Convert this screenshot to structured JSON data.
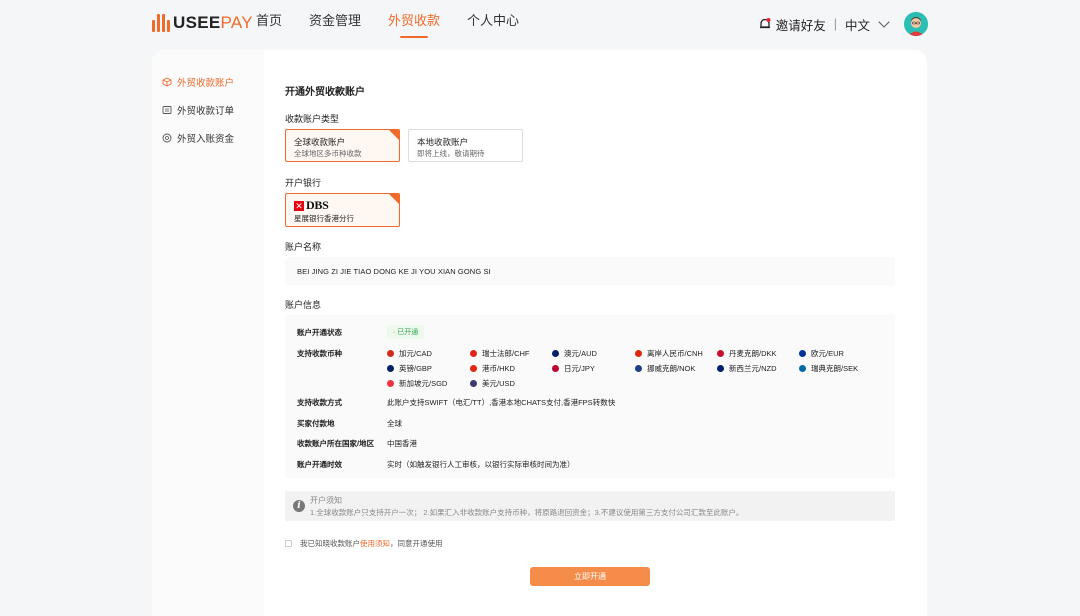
{
  "brand": {
    "logo_text": "USEE",
    "logo_text_accent": "PAY",
    "accent_color": "#f06b2b"
  },
  "nav": [
    {
      "label": "首页",
      "active": false
    },
    {
      "label": "资金管理",
      "active": false
    },
    {
      "label": "外贸收款",
      "active": true
    },
    {
      "label": "个人中心",
      "active": false
    }
  ],
  "header_right": {
    "invite": "邀请好友",
    "separator": "|",
    "language": "中文"
  },
  "sidebar": {
    "items": [
      {
        "label": "外贸收款账户",
        "icon": "box-icon",
        "active": true
      },
      {
        "label": "外贸收款订单",
        "icon": "list-icon",
        "active": false
      },
      {
        "label": "外贸入账资金",
        "icon": "coin-icon",
        "active": false
      }
    ]
  },
  "page": {
    "title": "开通外贸收款账户",
    "account_type_label": "收款账户类型",
    "account_types": [
      {
        "title": "全球收款账户",
        "subtitle": "全球地区多币种收款",
        "selected": true
      },
      {
        "title": "本地收款账户",
        "subtitle": "即将上线，敬请期待",
        "selected": false
      }
    ],
    "bank_label": "开户银行",
    "bank": {
      "logo": "DBS",
      "name": "星展银行香港分行"
    },
    "account_name_label": "账户名称",
    "account_name": "BEI JING ZI JIE TIAO DONG KE JI YOU XIAN GONG SI",
    "account_info_label": "账户信息",
    "info": {
      "status_key": "账户开通状态",
      "status_val": "· 已开通",
      "currency_key": "支持收款币种",
      "currencies": [
        {
          "label": "加元/CAD",
          "color": "#d52b1e"
        },
        {
          "label": "瑞士法郎/CHF",
          "color": "#e2231a"
        },
        {
          "label": "澳元/AUD",
          "color": "#012169"
        },
        {
          "label": "离岸人民币/CNH",
          "color": "#de2910"
        },
        {
          "label": "丹麦克朗/DKK",
          "color": "#c8102e"
        },
        {
          "label": "欧元/EUR",
          "color": "#003399"
        },
        {
          "label": "英镑/GBP",
          "color": "#012169"
        },
        {
          "label": "港币/HKD",
          "color": "#de2910"
        },
        {
          "label": "日元/JPY",
          "color": "#bc002d"
        },
        {
          "label": "挪威克朗/NOK",
          "color": "#1f3f8a"
        },
        {
          "label": "新西兰元/NZD",
          "color": "#012169"
        },
        {
          "label": "瑞典克朗/SEK",
          "color": "#006aa7"
        },
        {
          "label": "新加坡元/SGD",
          "color": "#ef3340"
        },
        {
          "label": "美元/USD",
          "color": "#3c3b6e"
        }
      ],
      "method_key": "支持收款方式",
      "method_val": "此账户支持SWIFT（电汇/TT）,香港本地CHATS支付,香港FPS转数快",
      "payer_key": "买家付款地",
      "payer_val": "全球",
      "region_key": "收款账户所在国家/地区",
      "region_val": "中国香港",
      "timing_key": "账户开通时效",
      "timing_val": "实时（如触发银行人工审核，以银行实际审核时间为准）"
    },
    "notice": {
      "title": "开户须知",
      "text": "1.全球收款账户只支持开户一次； 2.如果汇入非收款账户支持币种，将原路退回资金；3.不建议使用第三方支付公司汇款至此账户。"
    },
    "agree": {
      "prefix": "我已知晓收款账户",
      "link": "使用须知",
      "suffix": "，同意开通使用"
    },
    "submit_label": "立即开通"
  }
}
